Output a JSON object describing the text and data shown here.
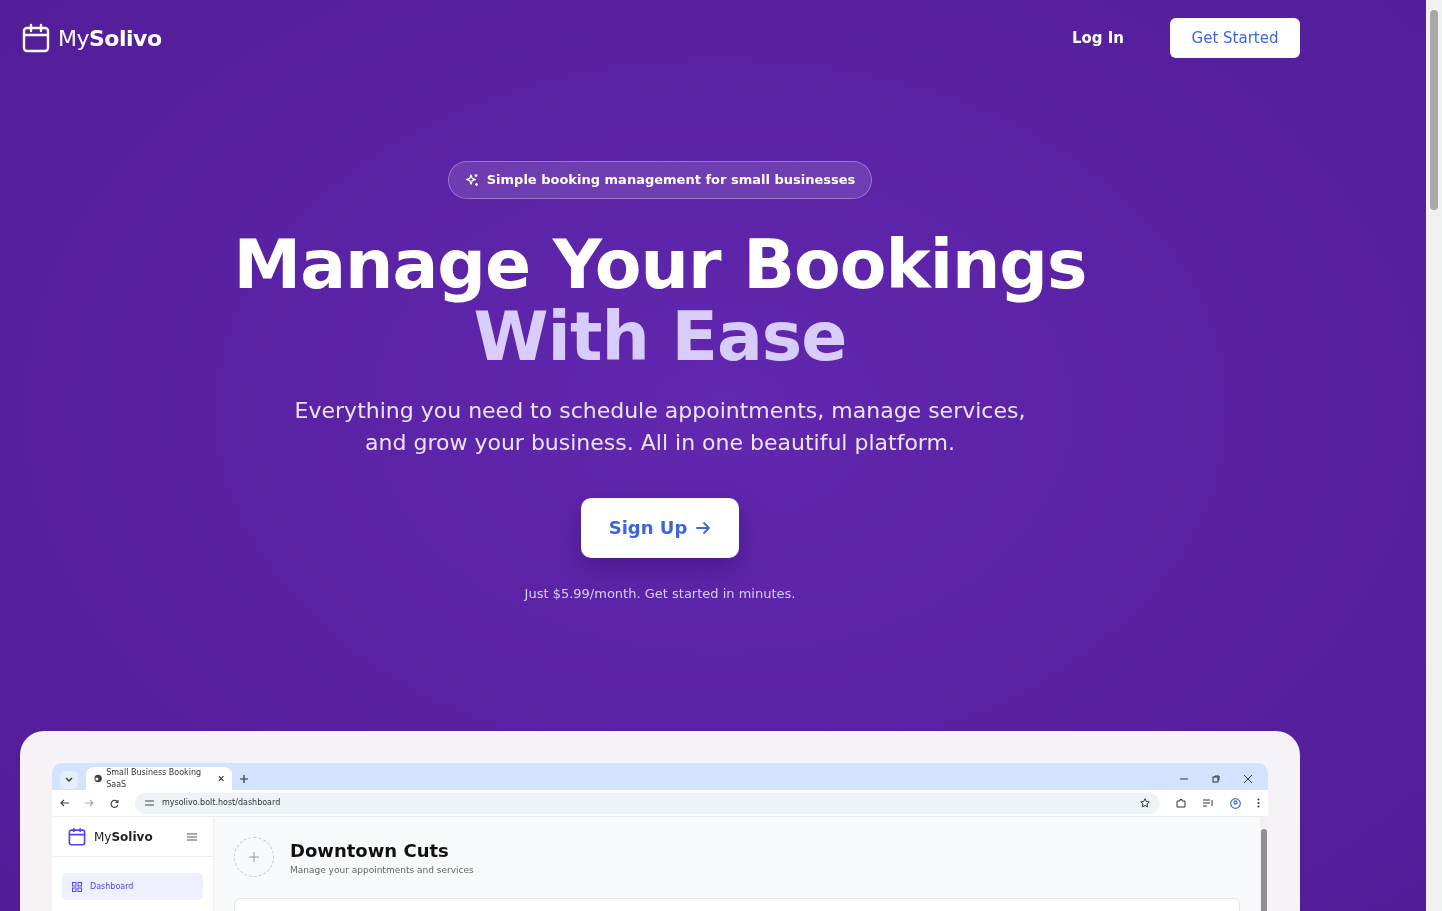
{
  "header": {
    "logo": {
      "prefix": "My",
      "name": "Solivo"
    },
    "login": "Log In",
    "cta": "Get Started"
  },
  "hero": {
    "badge": "Simple booking management for small businesses",
    "title_line1": "Manage Your Bookings",
    "title_line2": "With Ease",
    "subtitle": "Everything you need to schedule appointments, manage services, and grow your business. All in one beautiful platform.",
    "button": "Sign Up",
    "note": "Just $5.99/month. Get started in minutes."
  },
  "preview": {
    "tab_title": "Small Business Booking SaaS",
    "url": "mysolivo.bolt.host/dashboard",
    "app": {
      "logo": {
        "prefix": "My",
        "name": "Solivo"
      },
      "nav_items": [
        {
          "label": "Dashboard",
          "selected": true
        }
      ],
      "business_name": "Downtown Cuts",
      "business_subtitle": "Manage your appointments and services"
    }
  }
}
